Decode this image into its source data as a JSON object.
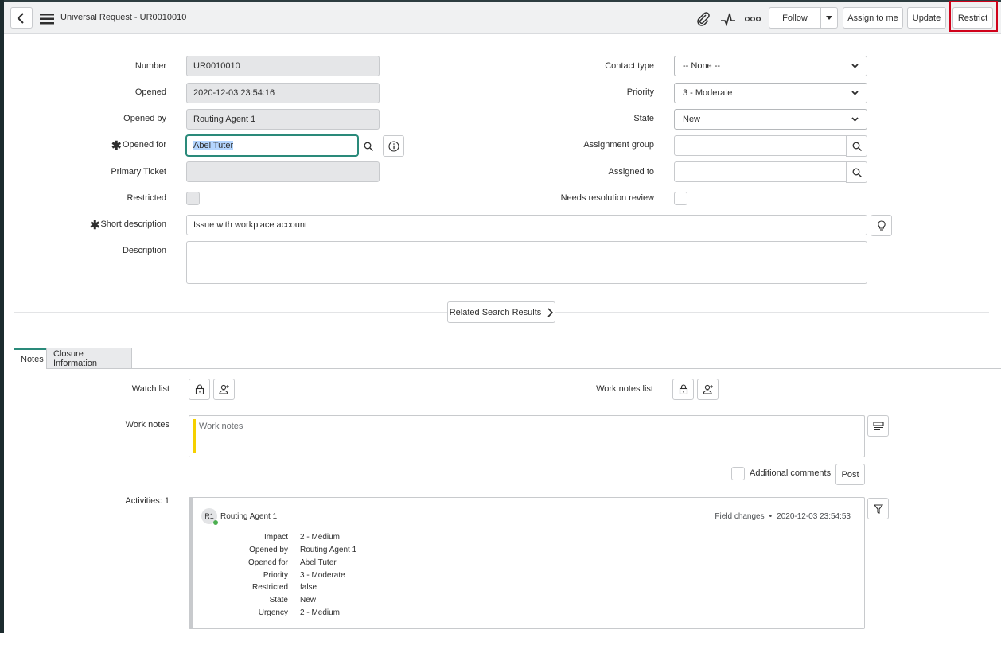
{
  "header": {
    "title": "Universal Request - UR0010010",
    "follow_label": "Follow",
    "assign_label": "Assign to me",
    "update_label": "Update",
    "restrict_label": "Restrict"
  },
  "form": {
    "number": {
      "label": "Number",
      "value": "UR0010010"
    },
    "opened": {
      "label": "Opened",
      "value": "2020-12-03 23:54:16"
    },
    "opened_by": {
      "label": "Opened by",
      "value": "Routing Agent 1"
    },
    "opened_for": {
      "label": "Opened for",
      "value": "Abel Tuter"
    },
    "primary_ticket": {
      "label": "Primary Ticket",
      "value": ""
    },
    "restricted": {
      "label": "Restricted"
    },
    "short_description": {
      "label": "Short description",
      "value": "Issue with workplace account"
    },
    "description": {
      "label": "Description",
      "value": ""
    },
    "contact_type": {
      "label": "Contact type",
      "value": "-- None --"
    },
    "priority": {
      "label": "Priority",
      "value": "3 - Moderate"
    },
    "state": {
      "label": "State",
      "value": "New"
    },
    "assignment_group": {
      "label": "Assignment group",
      "value": ""
    },
    "assigned_to": {
      "label": "Assigned to",
      "value": ""
    },
    "needs_review": {
      "label": "Needs resolution review"
    }
  },
  "related_label": "Related Search Results",
  "tabs": [
    {
      "label": "Notes",
      "active": true
    },
    {
      "label": "Closure Information",
      "active": false
    }
  ],
  "notes": {
    "watch_list_label": "Watch list",
    "work_notes_list_label": "Work notes list",
    "work_notes_label": "Work notes",
    "work_notes_placeholder": "Work notes",
    "additional_comments_label": "Additional comments",
    "post_label": "Post",
    "activities_label": "Activities: 1"
  },
  "activity": {
    "avatar": "R1",
    "author": "Routing Agent 1",
    "type": "Field changes",
    "separator": "•",
    "timestamp": "2020-12-03 23:54:53",
    "fields": [
      {
        "k": "Impact",
        "v": "2 - Medium"
      },
      {
        "k": "Opened by",
        "v": "Routing Agent 1"
      },
      {
        "k": "Opened for",
        "v": "Abel Tuter"
      },
      {
        "k": "Priority",
        "v": "3 - Moderate"
      },
      {
        "k": "Restricted",
        "v": "false"
      },
      {
        "k": "State",
        "v": "New"
      },
      {
        "k": "Urgency",
        "v": "2 - Medium"
      }
    ]
  },
  "colors": {
    "highlight_box": "#d0021b",
    "work_notes_bar": "#f5d000",
    "focus_border": "#2a8a7a",
    "online_dot": "#4caf50"
  }
}
